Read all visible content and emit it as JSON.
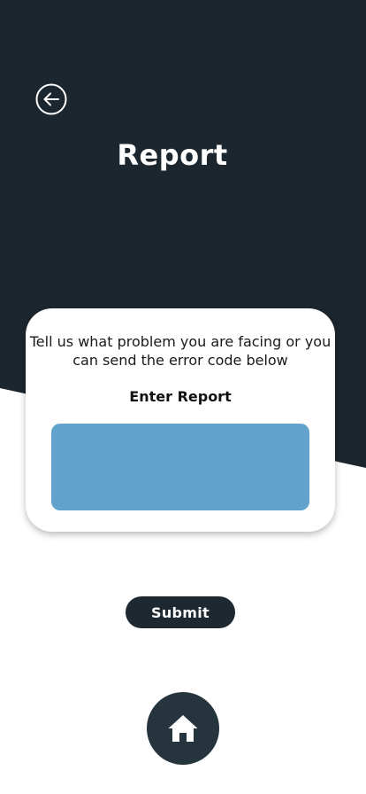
{
  "header": {
    "title": "Report",
    "back_icon": "arrow-left-circle-icon"
  },
  "card": {
    "description": "Tell us what problem you are facing or you can send the error code below",
    "label": "Enter Report",
    "input_value": ""
  },
  "actions": {
    "submit_label": "Submit",
    "home_icon": "home-icon"
  },
  "colors": {
    "dark_background": "#1b262e",
    "input_fill": "#62a3cd",
    "button": "#1d2830",
    "home_button": "#26343d",
    "card": "#ffffff"
  }
}
